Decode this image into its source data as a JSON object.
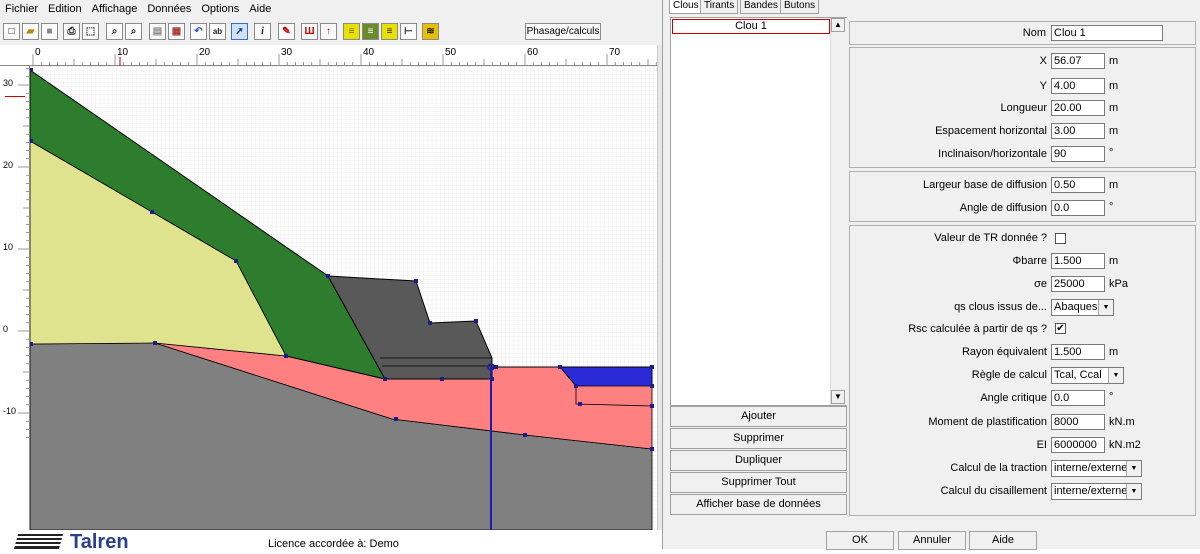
{
  "menu": [
    "Fichier",
    "Edition",
    "Affichage",
    "Données",
    "Options",
    "Aide"
  ],
  "toolbar": {
    "phasage_label": "Phasage/calculs",
    "info_label": "i"
  },
  "ruler_h": [
    "0",
    "10",
    "20",
    "30",
    "40",
    "50",
    "60",
    "70"
  ],
  "ruler_v": [
    "30",
    "20",
    "10",
    "0",
    "-10"
  ],
  "status": {
    "licence": "Licence accordée à: Demo",
    "logo_text": "Talren"
  },
  "tabs": [
    "Clous",
    "Tirants",
    "Bandes",
    "Butons"
  ],
  "list": {
    "items": [
      "Clou 1"
    ]
  },
  "list_buttons": [
    "Ajouter",
    "Supprimer",
    "Dupliquer",
    "Supprimer Tout",
    "Afficher base de données"
  ],
  "form": {
    "nom": {
      "label": "Nom",
      "value": "Clou 1"
    },
    "x": {
      "label": "X",
      "value": "56.07",
      "unit": "m"
    },
    "y": {
      "label": "Y",
      "value": "4.00",
      "unit": "m"
    },
    "longueur": {
      "label": "Longueur",
      "value": "20.00",
      "unit": "m"
    },
    "espacement": {
      "label": "Espacement horizontal",
      "value": "3.00",
      "unit": "m"
    },
    "inclinaison": {
      "label": "Inclinaison/horizontale",
      "value": "90",
      "unit": "°"
    },
    "largeur_base": {
      "label": "Largeur base de diffusion",
      "value": "0.50",
      "unit": "m"
    },
    "angle_diffusion": {
      "label": "Angle de diffusion",
      "value": "0.0",
      "unit": "°"
    },
    "valeur_tr": {
      "label": "Valeur de TR donnée ?",
      "checked": false
    },
    "phi_barre": {
      "label": "Φbarre",
      "value": "1.500",
      "unit": "m"
    },
    "sigma_e": {
      "label": "σe",
      "value": "25000",
      "unit": "kPa"
    },
    "qs_clous": {
      "label": "qs clous issus de...",
      "value": "Abaques"
    },
    "rsc": {
      "label": "Rsc calculée à partir de qs ?",
      "checked": true
    },
    "rayon": {
      "label": "Rayon équivalent",
      "value": "1.500",
      "unit": "m"
    },
    "regle": {
      "label": "Règle de calcul",
      "value": "Tcal, Ccal"
    },
    "angle_critique": {
      "label": "Angle critique",
      "value": "0.0",
      "unit": "°"
    },
    "moment": {
      "label": "Moment de plastification",
      "value": "8000",
      "unit": "kN.m"
    },
    "ei": {
      "label": "EI",
      "value": "6000000",
      "unit": "kN.m2"
    },
    "traction": {
      "label": "Calcul de la traction",
      "value": "interne/externe"
    },
    "cisaillement": {
      "label": "Calcul du cisaillement",
      "value": "interne/externe"
    }
  },
  "dialog_buttons": {
    "ok": "OK",
    "annuler": "Annuler",
    "aide": "Aide"
  },
  "colors": {
    "dark_green": "#2e7d2e",
    "light_yellow": "#e0e38d",
    "grey_soil": "#808080",
    "salmon": "#ff8080",
    "concrete": "#595959",
    "water": "#2a2ad6",
    "nail": "#1c1cb0"
  }
}
